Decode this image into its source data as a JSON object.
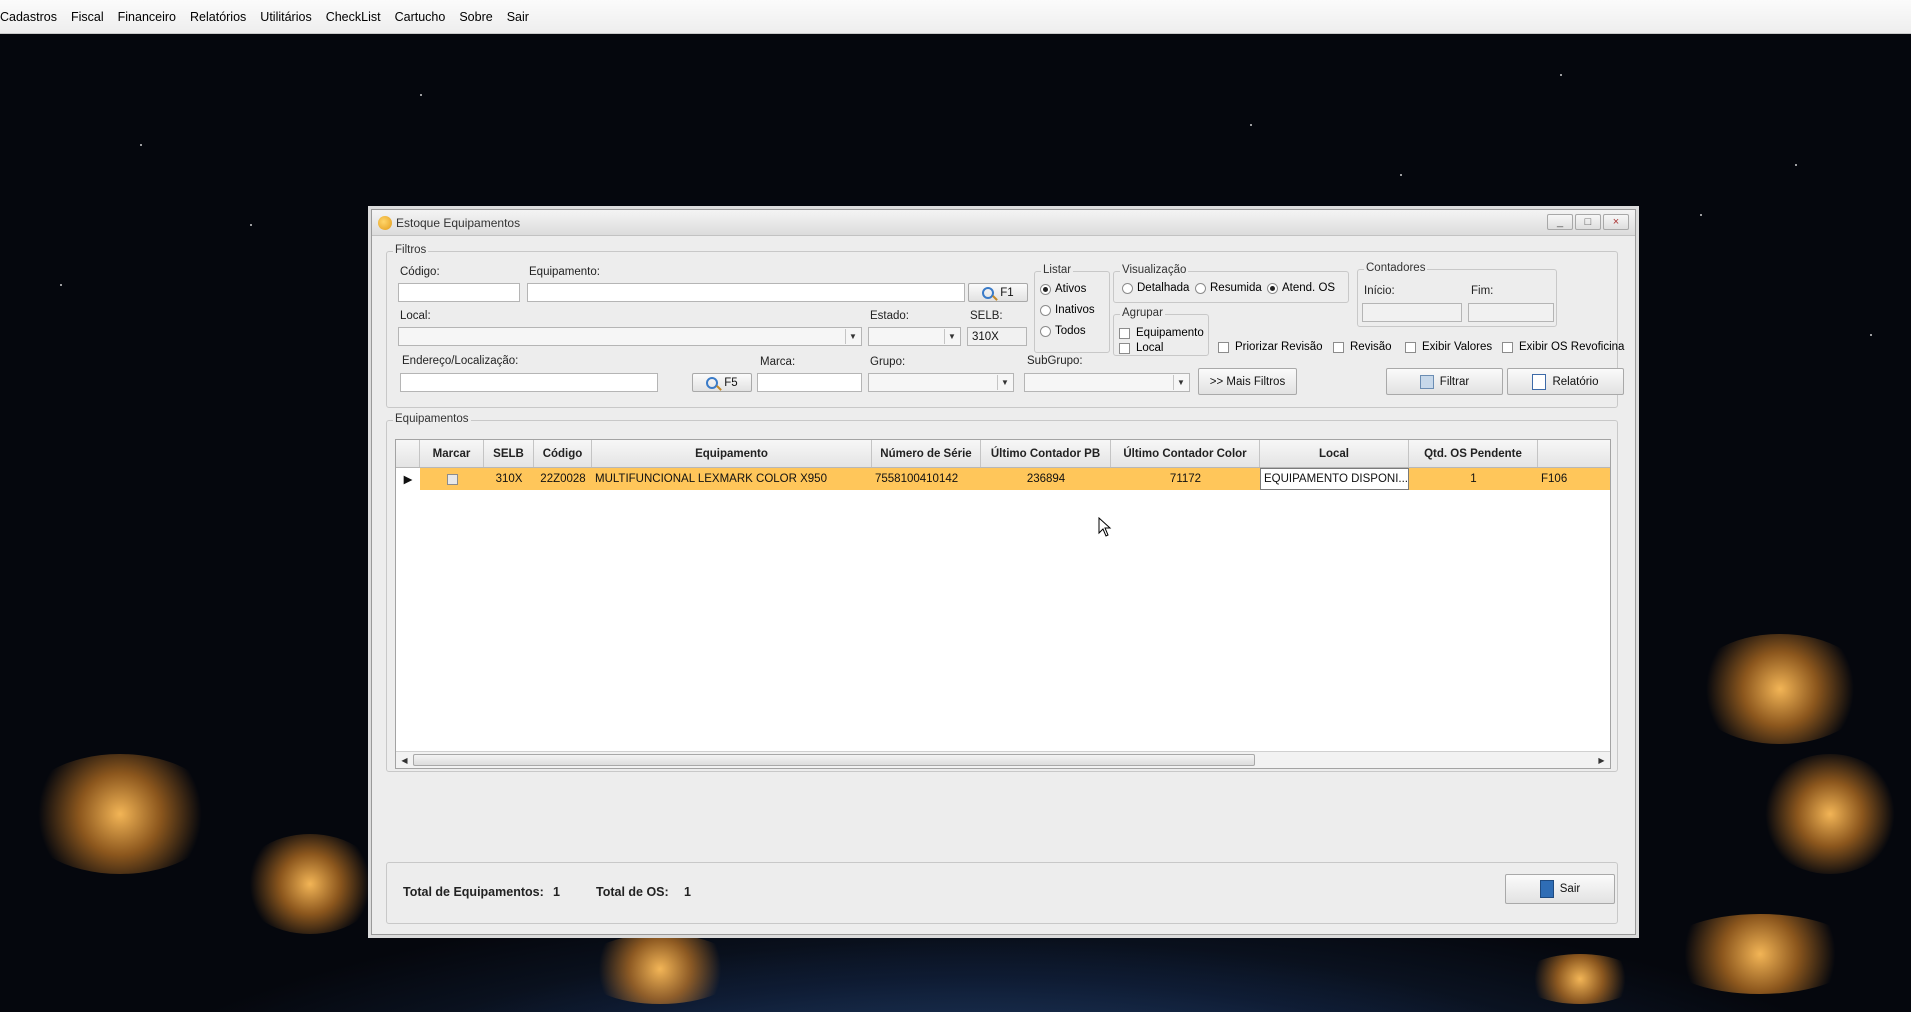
{
  "menubar": {
    "items": [
      "Cadastros",
      "Fiscal",
      "Financeiro",
      "Relatórios",
      "Utilitários",
      "CheckList",
      "Cartucho",
      "Sobre",
      "Sair"
    ]
  },
  "window": {
    "title": "Estoque Equipamentos",
    "min": "_",
    "max": "□",
    "close": "×"
  },
  "filtros": {
    "group_label": "Filtros",
    "codigo_label": "Código:",
    "codigo_value": "",
    "equipamento_label": "Equipamento:",
    "equipamento_value": "",
    "f1_label": "F1",
    "local_label": "Local:",
    "estado_label": "Estado:",
    "selb_label": "SELB:",
    "selb_value": "310X",
    "endereco_label": "Endereço/Localização:",
    "f5_label": "F5",
    "marca_label": "Marca:",
    "grupo_label": "Grupo:",
    "subgrupo_label": "SubGrupo:",
    "mais_filtros_label": ">> Mais Filtros",
    "listar": {
      "label": "Listar",
      "options": [
        "Ativos",
        "Inativos",
        "Todos"
      ],
      "selected": "Ativos"
    },
    "visualizacao": {
      "label": "Visualização",
      "options": [
        "Detalhada",
        "Resumida",
        "Atend. OS"
      ],
      "selected": "Atend. OS"
    },
    "agrupar": {
      "label": "Agrupar",
      "options": [
        "Equipamento",
        "Local"
      ]
    },
    "contadores": {
      "label": "Contadores",
      "inicio_label": "Início:",
      "fim_label": "Fim:"
    },
    "checks": [
      "Priorizar Revisão",
      "Revisão",
      "Exibir Valores",
      "Exibir OS Revoficina"
    ],
    "filtrar_label": "Filtrar",
    "relatorio_label": "Relatório"
  },
  "equipamentos": {
    "group_label": "Equipamentos",
    "columns": [
      "",
      "Marcar",
      "SELB",
      "Código",
      "Equipamento",
      "Número de Série",
      "Último Contador PB",
      "Último Contador Color",
      "Local",
      "Qtd. OS Pendente",
      ""
    ],
    "rows": [
      {
        "selb": "310X",
        "codigo": "22Z0028",
        "equipamento": "MULTIFUNCIONAL LEXMARK COLOR X950",
        "numero_serie": "7558100410142",
        "contador_pb": "236894",
        "contador_color": "71172",
        "local": "EQUIPAMENTO  DISPONI...",
        "qtd_os_pendente": "1",
        "extra": "F106"
      }
    ]
  },
  "footer": {
    "total_equipamentos_label": "Total de Equipamentos:",
    "total_equipamentos_value": "1",
    "total_os_label": "Total de OS:",
    "total_os_value": "1",
    "sair_label": "Sair"
  },
  "colors": {
    "row_highlight": "#ffc65a",
    "window_bg": "#ededed"
  }
}
